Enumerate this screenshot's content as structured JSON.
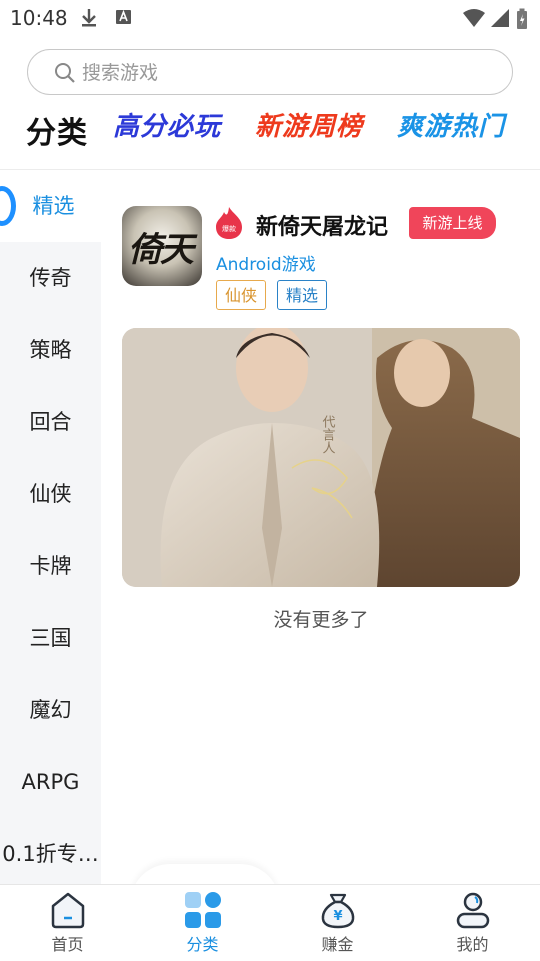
{
  "status_bar": {
    "time": "10:48"
  },
  "search": {
    "placeholder": "搜索游戏"
  },
  "header": {
    "title": "分类",
    "promos": [
      "高分必玩",
      "新游周榜",
      "爽游热门"
    ]
  },
  "sidebar": {
    "items": [
      {
        "label": "精选",
        "active": true
      },
      {
        "label": "传奇"
      },
      {
        "label": "策略"
      },
      {
        "label": "回合"
      },
      {
        "label": "仙侠"
      },
      {
        "label": "卡牌"
      },
      {
        "label": "三国"
      },
      {
        "label": "魔幻"
      },
      {
        "label": "ARPG"
      },
      {
        "label": "0.1折专…"
      }
    ]
  },
  "game": {
    "icon_text": "倚天",
    "name": "新倚天屠龙记",
    "badge": "新游上线",
    "platform": "Android游戏",
    "tags": [
      "仙侠",
      "精选"
    ],
    "hot_badge_text": "爆款"
  },
  "list_end": "没有更多了",
  "bottom_nav": [
    {
      "label": "首页",
      "icon": "home-icon"
    },
    {
      "label": "分类",
      "icon": "category-icon",
      "active": true
    },
    {
      "label": "赚金",
      "icon": "money-bag-icon"
    },
    {
      "label": "我的",
      "icon": "profile-icon"
    }
  ],
  "colors": {
    "accent": "#1a8fe0",
    "badge_red": "#f0455a",
    "tag_gold": "#d99530",
    "tag_blue": "#2a82c7"
  }
}
